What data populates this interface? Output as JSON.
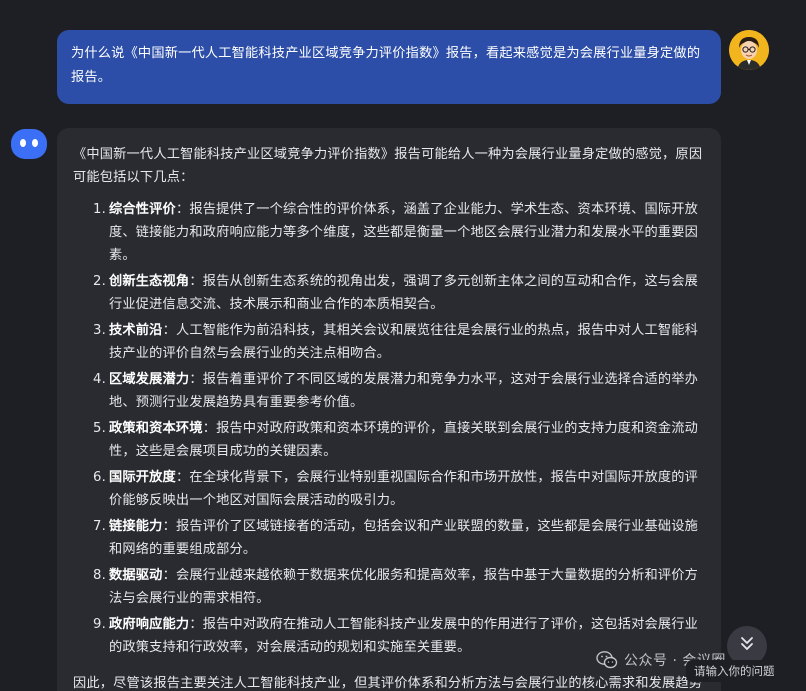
{
  "conversation": {
    "user_message": "为什么说《中国新一代人工智能科技产业区域竞争力评价指数》报告，看起来感觉是为会展行业量身定做的报告。",
    "bot_message": {
      "intro": "《中国新一代人工智能科技产业区域竞争力评价指数》报告可能给人一种为会展行业量身定做的感觉，原因可能包括以下几点：",
      "points": [
        {
          "num": "1.",
          "title": "综合性评价",
          "text": "：报告提供了一个综合性的评价体系，涵盖了企业能力、学术生态、资本环境、国际开放度、链接能力和政府响应能力等多个维度，这些都是衡量一个地区会展行业潜力和发展水平的重要因素。"
        },
        {
          "num": "2.",
          "title": "创新生态视角",
          "text": "：报告从创新生态系统的视角出发，强调了多元创新主体之间的互动和合作，这与会展行业促进信息交流、技术展示和商业合作的本质相契合。"
        },
        {
          "num": "3.",
          "title": "技术前沿",
          "text": "：人工智能作为前沿科技，其相关会议和展览往往是会展行业的热点，报告中对人工智能科技产业的评价自然与会展行业的关注点相吻合。"
        },
        {
          "num": "4.",
          "title": "区域发展潜力",
          "text": "：报告着重评价了不同区域的发展潜力和竞争力水平，这对于会展行业选择合适的举办地、预测行业发展趋势具有重要参考价值。"
        },
        {
          "num": "5.",
          "title": "政策和资本环境",
          "text": "：报告中对政府政策和资本环境的评价，直接关联到会展行业的支持力度和资金流动性，这些是会展项目成功的关键因素。"
        },
        {
          "num": "6.",
          "title": "国际开放度",
          "text": "：在全球化背景下，会展行业特别重视国际合作和市场开放性，报告中对国际开放度的评价能够反映出一个地区对国际会展活动的吸引力。"
        },
        {
          "num": "7.",
          "title": "链接能力",
          "text": "：报告评价了区域链接者的活动，包括会议和产业联盟的数量，这些都是会展行业基础设施和网络的重要组成部分。"
        },
        {
          "num": "8.",
          "title": "数据驱动",
          "text": "：会展行业越来越依赖于数据来优化服务和提高效率，报告中基于大量数据的分析和评价方法与会展行业的需求相符。"
        },
        {
          "num": "9.",
          "title": "政府响应能力",
          "text": "：报告中对政府在推动人工智能科技产业发展中的作用进行了评价，这包括对会展行业的政策支持和行政效率，对会展活动的规划和实施至关重要。"
        }
      ],
      "conclusion": "因此，尽管该报告主要关注人工智能科技产业，但其评价体系和分析方法与会展行业的核心需求和发展趋势高度相关，从而给人一种为会展行业量身定做的感觉。"
    }
  },
  "watermark": {
    "text": "公众号 · 会议圈"
  },
  "input": {
    "placeholder": "请输入你的问题"
  },
  "icons": {
    "user_avatar": "user-avatar-icon",
    "bot_avatar": "bot-avatar-icon",
    "scroll_down": "double-chevron-down-icon",
    "wechat": "wechat-icon"
  },
  "colors": {
    "background": "#1e1f24",
    "user_bubble": "#2c4ea8",
    "bot_bubble": "#2a2b31",
    "bot_avatar": "#3b6ff5",
    "user_avatar_bg": "#f3b51d"
  }
}
